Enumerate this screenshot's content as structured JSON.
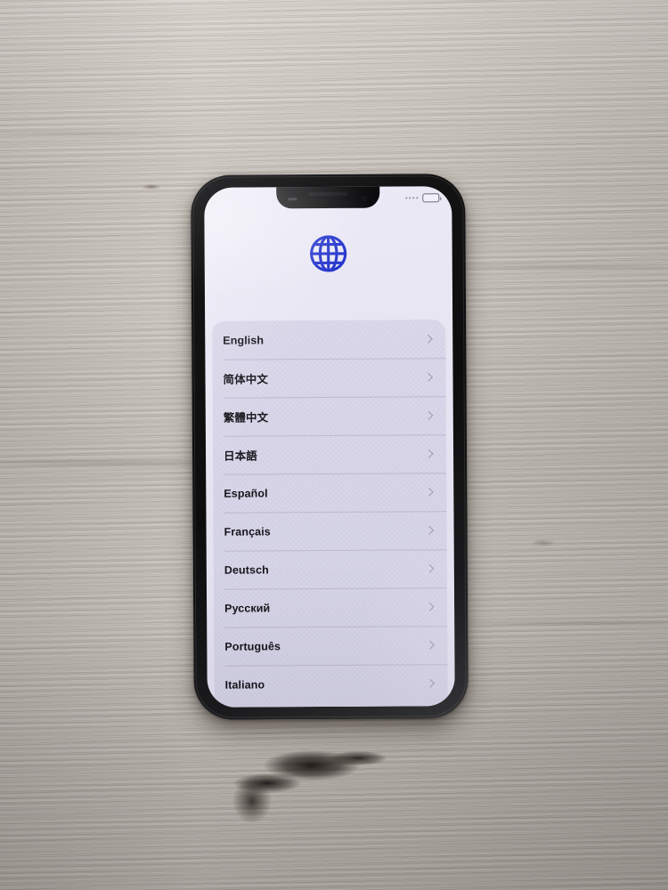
{
  "scene": {
    "description": "iPhone on light wood surface showing language selection screen",
    "surface": "light grey oak wood",
    "wood_color": "#c7c1b9",
    "device_body_color": "#131314"
  },
  "device": {
    "notch": {
      "speaker": "earpiece-speaker",
      "camera": "front-camera",
      "sensor": "proximity-sensor"
    },
    "status_bar": {
      "signal_dots": 4,
      "battery": {
        "icon": "battery-icon",
        "fill_percent": 52
      }
    }
  },
  "screen": {
    "background_color": "#e6e4f2",
    "header": {
      "icon": "globe-icon",
      "icon_color": "#2233cc"
    },
    "language_list": {
      "card_color": "#d5d3e6",
      "chevron_icon": "chevron-right-icon",
      "items": [
        {
          "label": "English"
        },
        {
          "label": "简体中文"
        },
        {
          "label": "繁體中文"
        },
        {
          "label": "日本語"
        },
        {
          "label": "Español"
        },
        {
          "label": "Français"
        },
        {
          "label": "Deutsch"
        },
        {
          "label": "Русский"
        },
        {
          "label": "Português"
        },
        {
          "label": "Italiano"
        }
      ]
    }
  }
}
